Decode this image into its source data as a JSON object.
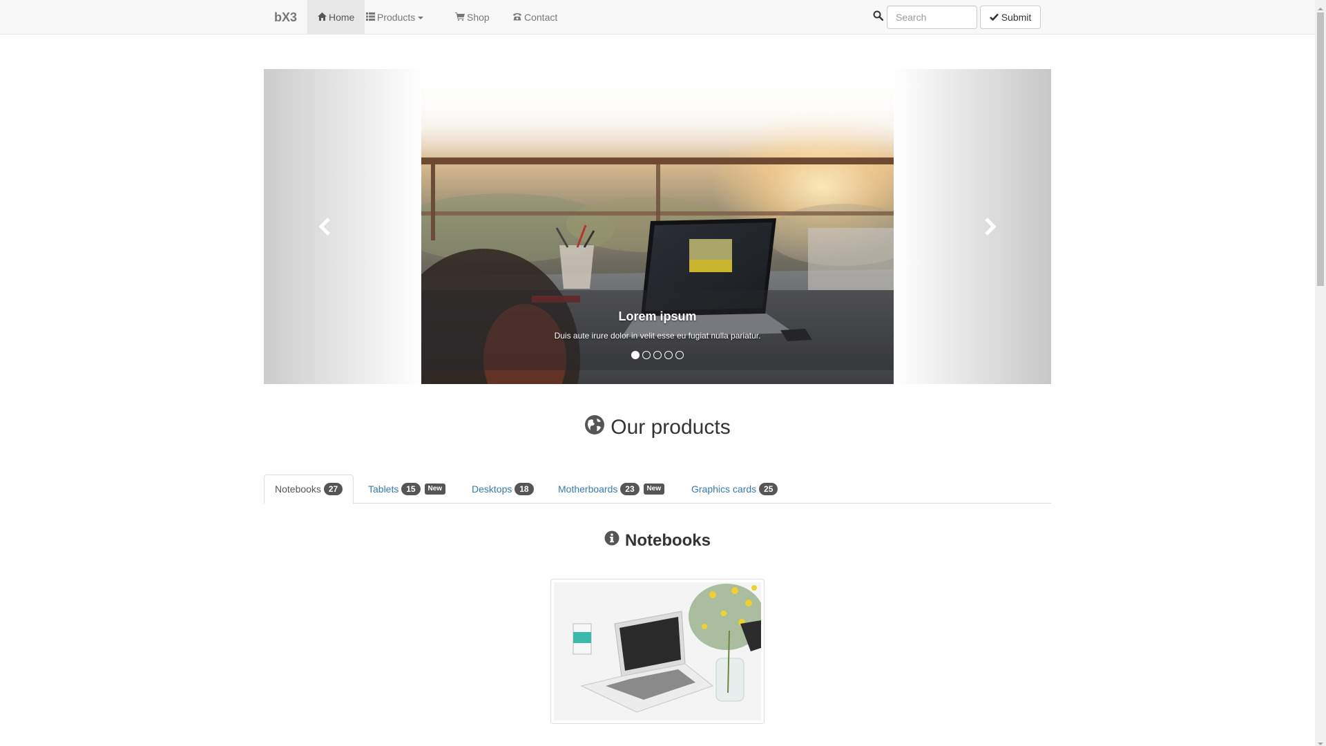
{
  "navbar": {
    "brand": "bX3",
    "items": [
      {
        "label": "Home",
        "icon": "home-icon",
        "active": true
      },
      {
        "label": "Products",
        "icon": "list-icon",
        "dropdown": true
      },
      {
        "label": "Shop",
        "icon": "shopping-cart-icon"
      },
      {
        "label": "Contact",
        "icon": "phone-icon"
      }
    ],
    "search": {
      "placeholder": "Search",
      "value": ""
    },
    "submit_label": "Submit"
  },
  "carousel": {
    "caption_title": "Lorem ipsum",
    "caption_text": "Duis aute irure dolor in velit esse eu fugiat nulla pariatur.",
    "slide_count": 5,
    "active_slide": 1
  },
  "section": {
    "title": "Our products",
    "icon": "globe-icon"
  },
  "tabs": [
    {
      "label": "Notebooks",
      "count": "27",
      "active": true
    },
    {
      "label": "Tablets",
      "count": "15",
      "badge_new": "New"
    },
    {
      "label": "Desktops",
      "count": "18"
    },
    {
      "label": "Motherboards",
      "count": "23",
      "badge_new": "New"
    },
    {
      "label": "Graphics cards",
      "count": "25"
    }
  ],
  "tab_panel": {
    "title": "Notebooks",
    "icon": "info-sign-icon"
  },
  "colors": {
    "link": "#337ab7",
    "navbar_bg": "#f8f8f8",
    "badge_bg": "#555555"
  }
}
